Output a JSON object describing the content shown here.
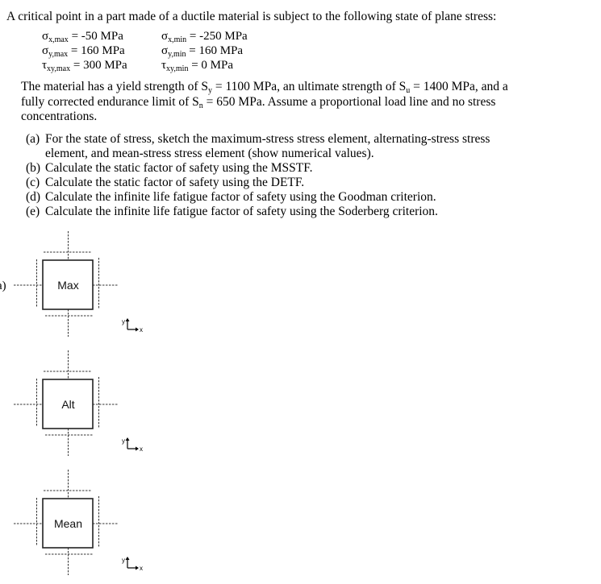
{
  "problem": {
    "intro": "A critical point in a part made of a ductile material is subject to the following state of plane stress:",
    "stresses": {
      "max": [
        {
          "symbol": "σ",
          "sub": "x,max",
          "value": " = -50 MPa"
        },
        {
          "symbol": "σ",
          "sub": "y,max",
          "value": " = 160 MPa"
        },
        {
          "symbol": "τ",
          "sub": "xy,max",
          "value": " = 300 MPa"
        }
      ],
      "min": [
        {
          "symbol": "σ",
          "sub": "x,min",
          "value": " = -250 MPa"
        },
        {
          "symbol": "σ",
          "sub": "y,min",
          "value": " = 160 MPa"
        },
        {
          "symbol": "τ",
          "sub": "xy,min",
          "value": " = 0 MPa"
        }
      ]
    },
    "material": {
      "line1_a": "The material has a yield strength of S",
      "line1_sub1": "y",
      "line1_b": " = 1100 MPa, an ultimate strength of S",
      "line1_sub2": "u",
      "line1_c": " = 1400 MPa, and a",
      "line2_a": "fully corrected endurance limit of S",
      "line2_sub": "n",
      "line2_b": " = 650 MPa. Assume a proportional load line and no stress",
      "line3": "concentrations."
    },
    "tasks": [
      {
        "label": "(a)",
        "lines": [
          "For the state of stress, sketch the maximum-stress stress element, alternating-stress stress",
          "element, and mean-stress stress element (show numerical values)."
        ]
      },
      {
        "label": "(b)",
        "lines": [
          "Calculate the static factor of safety using the MSSTF."
        ]
      },
      {
        "label": "(c)",
        "lines": [
          "Calculate the static factor of safety using the DETF."
        ]
      },
      {
        "label": "(d)",
        "lines": [
          "Calculate the infinite life fatigue factor of safety using the Goodman criterion."
        ]
      },
      {
        "label": "(e)",
        "lines": [
          "Calculate the infinite life fatigue factor of safety using the Soderberg criterion."
        ]
      }
    ]
  },
  "answer_area": {
    "part_label": "a)",
    "elements": [
      {
        "label": "Max"
      },
      {
        "label": "Alt"
      },
      {
        "label": "Mean"
      }
    ],
    "axes": {
      "x": "x",
      "y": "y"
    }
  }
}
